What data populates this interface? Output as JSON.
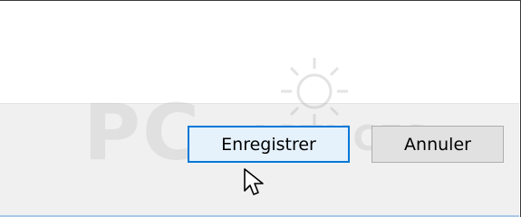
{
  "dialog": {
    "buttons": {
      "save_label": "Enregistrer",
      "cancel_label": "Annuler"
    }
  },
  "watermark": {
    "brand_big": "PC",
    "brand_small": "ASTUCES"
  },
  "colors": {
    "accent_border": "#0078d7",
    "primary_button_bg": "#e5f1fb",
    "button_bg": "#e1e1e1",
    "button_bar_bg": "#f0f0f0"
  },
  "icons": {
    "watermark_logo": "lightbulb-sun-icon",
    "pointer": "mouse-pointer-icon"
  }
}
